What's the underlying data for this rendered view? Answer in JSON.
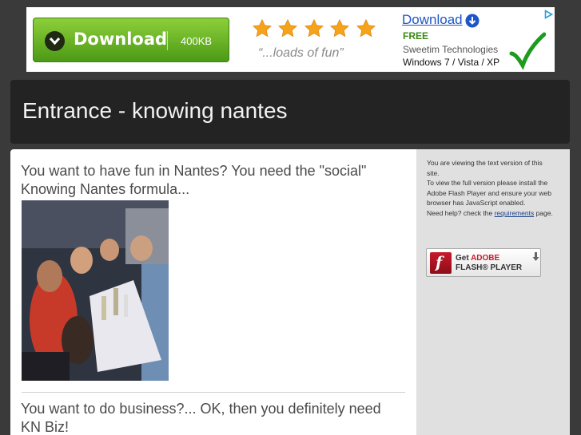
{
  "ad": {
    "button_label": "Download",
    "button_size": "400KB",
    "rating_stars": 5,
    "tagline": "“...loads of fun”",
    "download_link": "Download",
    "free_label": "FREE",
    "company": "Sweetim Technologies",
    "os": "Windows 7 / Vista / XP",
    "colors": {
      "button": "#5fb322",
      "link": "#1e56c8",
      "free": "#3b8a14",
      "check": "#1e9a1e",
      "star": "#f5a31a"
    }
  },
  "header": {
    "title": "Entrance - knowing nantes"
  },
  "main": {
    "intro": "You want to have fun in Nantes? You need the \"social\" Knowing Nantes formula...",
    "business": "You want to do business?... OK, then you definitely need KN Biz!"
  },
  "sidebar": {
    "line1": "You are viewing the text version of this site.",
    "line2": "To view the full version please install the Adobe Flash Player and ensure your web browser has JavaScript enabled.",
    "help_prefix": "Need help? check the ",
    "help_link": "requirements",
    "help_suffix": " page.",
    "flash_get": "Get ",
    "flash_adobe": "ADOBE",
    "flash_player": "FLASH® PLAYER"
  }
}
